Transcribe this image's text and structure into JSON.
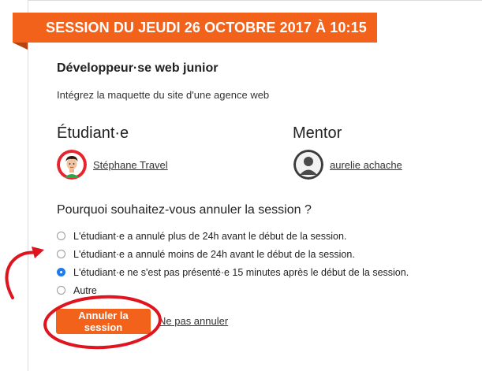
{
  "session": {
    "banner": "SESSION DU JEUDI 26 OCTOBRE 2017 À 10:15",
    "course_title": "Développeur·se web junior",
    "course_subtitle": "Intégrez la maquette du site d'une agence web"
  },
  "participants": {
    "student_heading": "Étudiant·e",
    "student_name": "Stéphane Travel",
    "mentor_heading": "Mentor",
    "mentor_name": "aurelie achache"
  },
  "cancel_form": {
    "question": "Pourquoi souhaitez-vous annuler la session ?",
    "options": [
      {
        "label": "L'étudiant·e a annulé plus de 24h avant le début de la session.",
        "checked": false
      },
      {
        "label": "L'étudiant·e a annulé moins de 24h avant le début de la session.",
        "checked": false
      },
      {
        "label": "L'étudiant·e ne s'est pas présenté·e 15 minutes après le début de la session.",
        "checked": true
      },
      {
        "label": "Autre",
        "checked": false
      }
    ],
    "submit_label": "Annuler la session",
    "keep_label": "Ne pas annuler"
  },
  "colors": {
    "accent": "#f2621a",
    "annotation": "#e0141e",
    "radio_selected": "#1a7cf0"
  },
  "icons": [
    "student-avatar-icon",
    "mentor-avatar-icon",
    "annotation-arrow-icon",
    "annotation-circle-icon"
  ]
}
